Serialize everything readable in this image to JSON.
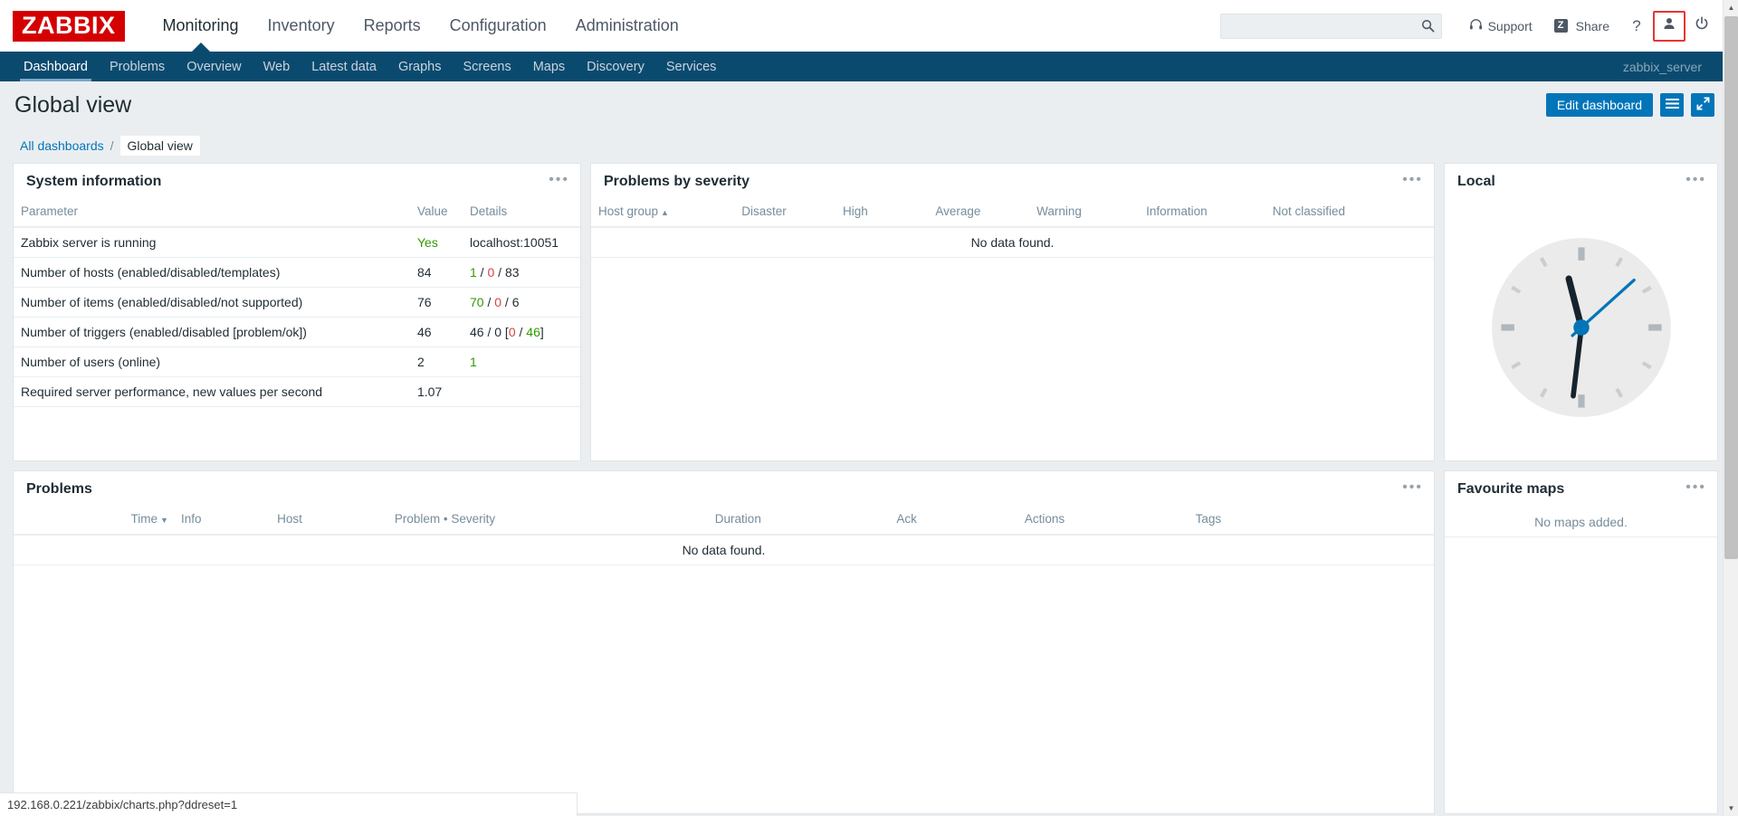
{
  "header": {
    "logo_text": "ZABBIX",
    "menu": [
      {
        "label": "Monitoring",
        "active": true
      },
      {
        "label": "Inventory",
        "active": false
      },
      {
        "label": "Reports",
        "active": false
      },
      {
        "label": "Configuration",
        "active": false
      },
      {
        "label": "Administration",
        "active": false
      }
    ],
    "search": {
      "value": "",
      "placeholder": ""
    },
    "support_label": "Support",
    "share_label": "Share",
    "share_badge": "Z",
    "help_label": "?",
    "accent_color": "#d40000",
    "nav_color": "#0b4a6f",
    "focus_color": "#e33734"
  },
  "subnav": {
    "items": [
      {
        "label": "Dashboard",
        "active": true
      },
      {
        "label": "Problems",
        "active": false
      },
      {
        "label": "Overview",
        "active": false
      },
      {
        "label": "Web",
        "active": false
      },
      {
        "label": "Latest data",
        "active": false
      },
      {
        "label": "Graphs",
        "active": false
      },
      {
        "label": "Screens",
        "active": false
      },
      {
        "label": "Maps",
        "active": false
      },
      {
        "label": "Discovery",
        "active": false
      },
      {
        "label": "Services",
        "active": false
      }
    ],
    "server_name": "zabbix_server"
  },
  "title_bar": {
    "title": "Global view",
    "edit_button": "Edit dashboard"
  },
  "breadcrumb": {
    "all_dashboards": "All dashboards",
    "separator": "/",
    "current": "Global view"
  },
  "widgets": {
    "system_information": {
      "title": "System information",
      "columns": [
        "Parameter",
        "Value",
        "Details"
      ],
      "rows": [
        {
          "parameter": "Zabbix server is running",
          "value": "Yes",
          "value_color": "green",
          "details": [
            {
              "text": "localhost:10051",
              "color": "grey"
            }
          ]
        },
        {
          "parameter": "Number of hosts (enabled/disabled/templates)",
          "value": "84",
          "value_color": "grey",
          "details": [
            {
              "text": "1",
              "color": "green"
            },
            {
              "text": " / ",
              "color": "grey"
            },
            {
              "text": "0",
              "color": "red"
            },
            {
              "text": " / ",
              "color": "grey"
            },
            {
              "text": "83",
              "color": "grey"
            }
          ]
        },
        {
          "parameter": "Number of items (enabled/disabled/not supported)",
          "value": "76",
          "value_color": "grey",
          "details": [
            {
              "text": "70",
              "color": "green"
            },
            {
              "text": " / ",
              "color": "grey"
            },
            {
              "text": "0",
              "color": "red"
            },
            {
              "text": " / ",
              "color": "grey"
            },
            {
              "text": "6",
              "color": "grey"
            }
          ]
        },
        {
          "parameter": "Number of triggers (enabled/disabled [problem/ok])",
          "value": "46",
          "value_color": "grey",
          "details": [
            {
              "text": "46 / 0 [",
              "color": "grey"
            },
            {
              "text": "0",
              "color": "red"
            },
            {
              "text": " / ",
              "color": "grey"
            },
            {
              "text": "46",
              "color": "green"
            },
            {
              "text": "]",
              "color": "grey"
            }
          ]
        },
        {
          "parameter": "Number of users (online)",
          "value": "2",
          "value_color": "grey",
          "details": [
            {
              "text": "1",
              "color": "green"
            }
          ]
        },
        {
          "parameter": "Required server performance, new values per second",
          "value": "1.07",
          "value_color": "grey",
          "details": []
        }
      ]
    },
    "problems_by_severity": {
      "title": "Problems by severity",
      "columns": [
        "Host group",
        "Disaster",
        "High",
        "Average",
        "Warning",
        "Information",
        "Not classified"
      ],
      "sort_column": "Host group",
      "sort_direction": "asc",
      "empty_text": "No data found."
    },
    "local_clock": {
      "title": "Local",
      "hours": 11,
      "minutes": 31,
      "seconds": 8,
      "hand_color": "#0275b8",
      "dial_color": "#ebebeb"
    },
    "problems": {
      "title": "Problems",
      "columns": [
        "Time",
        "Info",
        "Host",
        "Problem • Severity",
        "Duration",
        "Ack",
        "Actions",
        "Tags"
      ],
      "sort_column": "Time",
      "sort_direction": "desc",
      "empty_text": "No data found."
    },
    "favourite_maps": {
      "title": "Favourite maps",
      "empty_text": "No maps added."
    }
  },
  "status_bar": {
    "url": "192.168.0.221/zabbix/charts.php?ddreset=1"
  }
}
